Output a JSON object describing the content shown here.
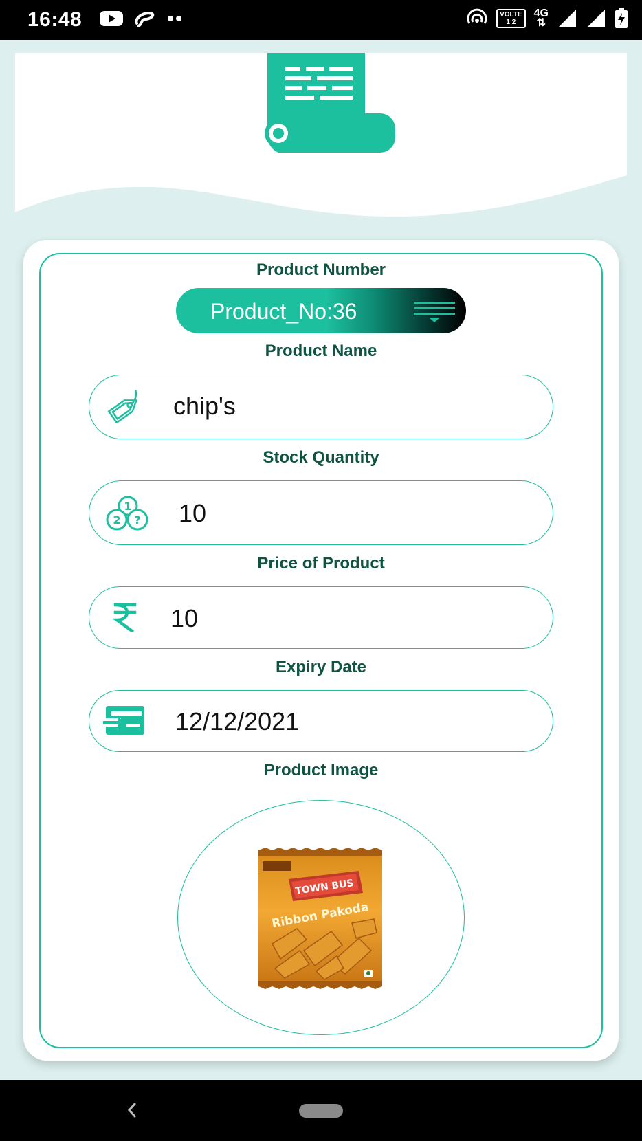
{
  "status_bar": {
    "time": "16:48",
    "left_icons": [
      "youtube-icon",
      "airtel-icon",
      "more-dots-icon"
    ],
    "right_icons": [
      "hotspot-icon",
      "volte-icon",
      "4g-icon",
      "signal-icon",
      "signal-icon",
      "battery-charging-icon"
    ],
    "volte_line1": "VOLTE",
    "volte_line2": "1 2",
    "network": "4G"
  },
  "header": {
    "logo": "receipt-scroll-icon"
  },
  "form": {
    "product_number_label": "Product Number",
    "product_number_value": "Product_No:36",
    "product_name_label": "Product Name",
    "product_name_value": "chip's",
    "stock_quantity_label": "Stock Quantity",
    "stock_quantity_value": "10",
    "price_label": "Price of Product",
    "price_value": "10",
    "expiry_label": "Expiry Date",
    "expiry_value": "12/12/2021",
    "image_label": "Product Image"
  },
  "product_image": {
    "brand": "TOWN BUS",
    "name": "Ribbon Pakoda"
  },
  "colors": {
    "accent": "#1cbf9e",
    "label_text": "#0f5443",
    "page_bg": "#ddf0ef"
  }
}
